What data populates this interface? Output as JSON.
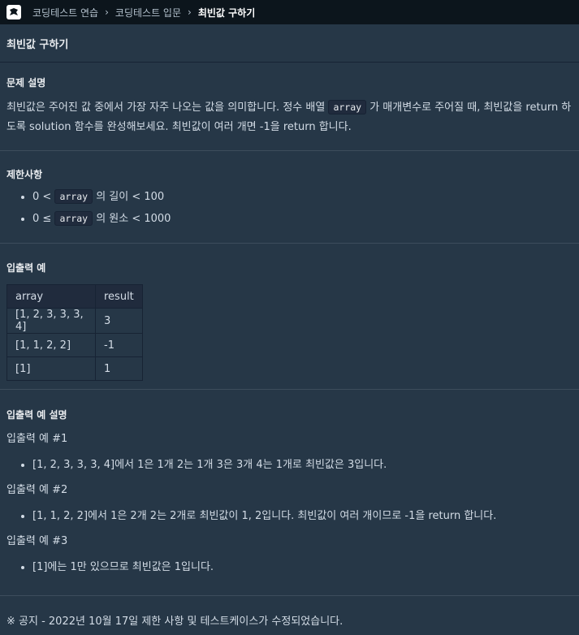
{
  "breadcrumb": [
    "코딩테스트 연습",
    "코딩테스트 입문",
    "최빈값 구하기"
  ],
  "title": "최빈값 구하기",
  "problem": {
    "heading": "문제 설명",
    "text1": "최빈값은 주어진 값 중에서 가장 자주 나오는 값을 의미합니다. 정수 배열 ",
    "code": "array",
    "text2": " 가 매개변수로 주어질 때, 최빈값을 return 하도록 solution 함수를 완성해보세요. 최빈값이 여러 개면 -1을 return 합니다."
  },
  "constraints": {
    "heading": "제한사항",
    "items": [
      {
        "prefix": "0 < ",
        "code": "array",
        "suffix": " 의 길이 < 100"
      },
      {
        "prefix": "0 ≤ ",
        "code": "array",
        "suffix": " 의 원소 < 1000"
      }
    ]
  },
  "examples": {
    "heading": "입출력 예",
    "headers": [
      "array",
      "result"
    ],
    "rows": [
      [
        "[1, 2, 3, 3, 3, 4]",
        "3"
      ],
      [
        "[1, 1, 2, 2]",
        "-1"
      ],
      [
        "[1]",
        "1"
      ]
    ]
  },
  "explanation": {
    "heading": "입출력 예 설명",
    "cases": [
      {
        "title": "입출력 예 #1",
        "text": "[1, 2, 3, 3, 3, 4]에서 1은 1개 2는 1개 3은 3개 4는 1개로 최빈값은 3입니다."
      },
      {
        "title": "입출력 예 #2",
        "text": "[1, 1, 2, 2]에서 1은 2개 2는 2개로 최빈값이 1, 2입니다. 최빈값이 여러 개이므로 -1을 return 합니다."
      },
      {
        "title": "입출력 예 #3",
        "text": "[1]에는 1만 있으므로 최빈값은 1입니다."
      }
    ]
  },
  "notice": "※ 공지 - 2022년 10월 17일 제한 사항 및 테스트케이스가 수정되었습니다."
}
